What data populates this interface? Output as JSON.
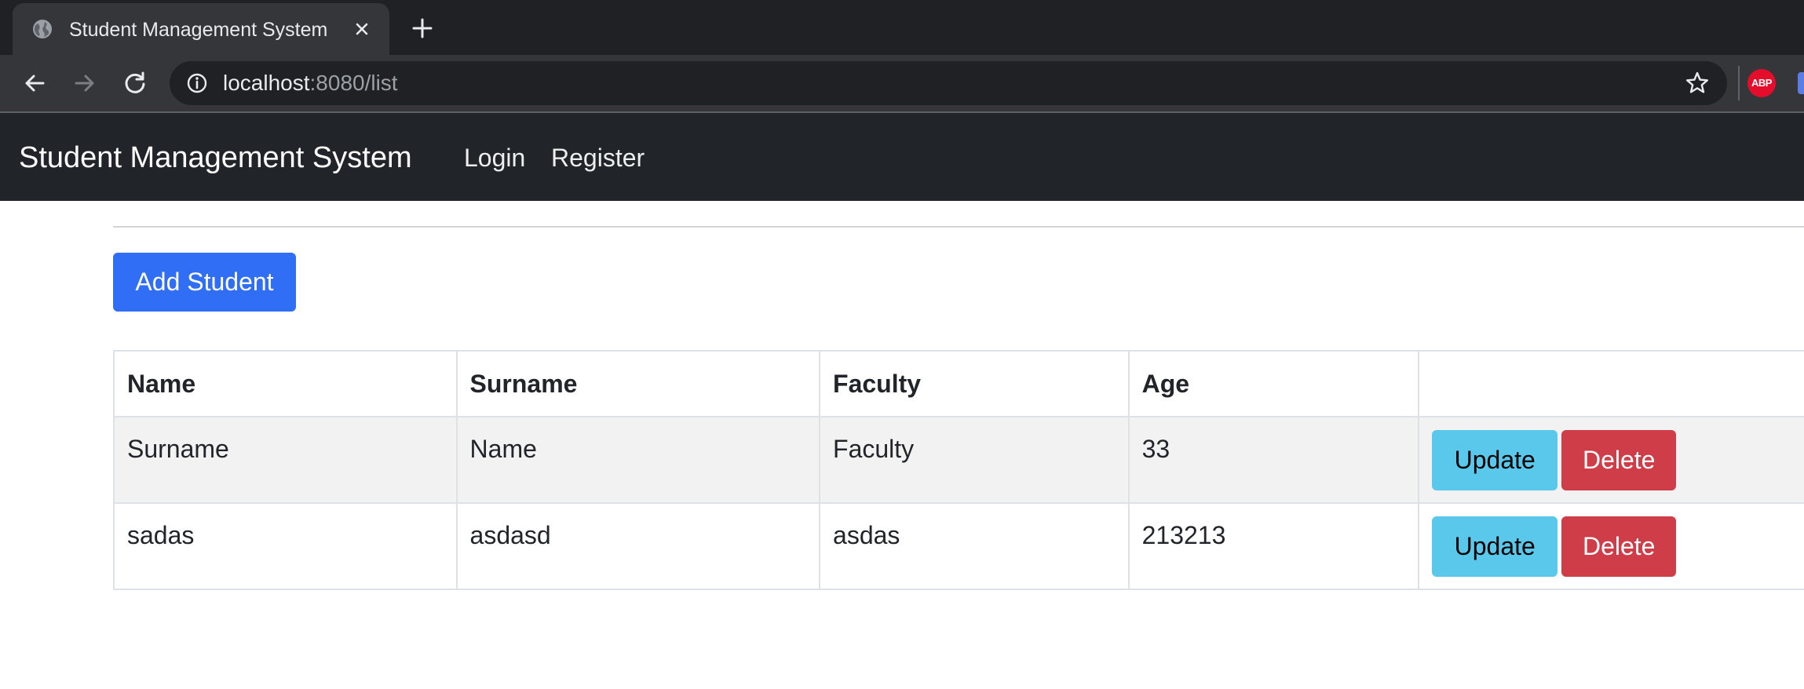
{
  "browser": {
    "tab_title": "Student Management System",
    "url_host": "localhost",
    "url_rest": ":8080/list",
    "extension_label": "ABP"
  },
  "navbar": {
    "brand": "Student Management System",
    "links": [
      "Login",
      "Register"
    ]
  },
  "content": {
    "add_button_label": "Add Student",
    "table": {
      "headers": [
        "Name",
        "Surname",
        "Faculty",
        "Age",
        ""
      ],
      "rows": [
        {
          "name": "Surname",
          "surname": "Name",
          "faculty": "Faculty",
          "age": "33"
        },
        {
          "name": "sadas",
          "surname": "asdasd",
          "faculty": "asdas",
          "age": "213213"
        }
      ],
      "update_label": "Update",
      "delete_label": "Delete"
    }
  },
  "colors": {
    "navbar_bg": "#212529",
    "primary": "#2f6ef5",
    "info": "#5ac8ea",
    "danger": "#cf3e48"
  }
}
